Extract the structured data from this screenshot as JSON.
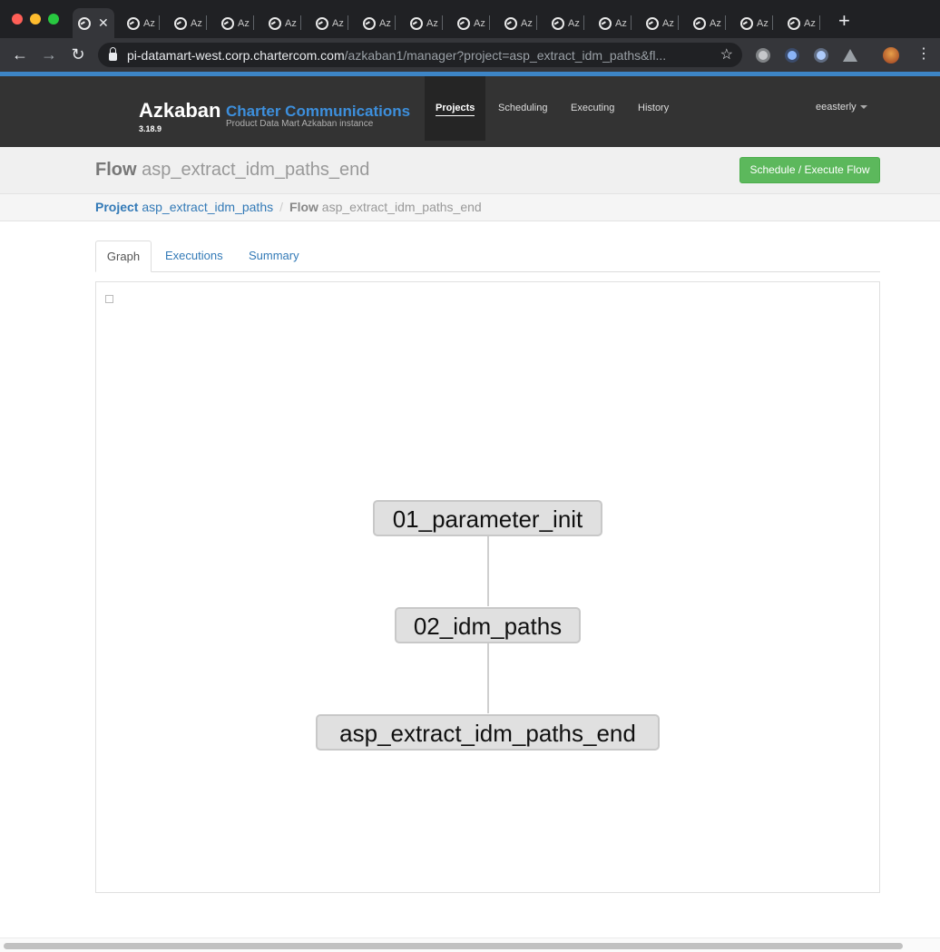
{
  "browser": {
    "tab_label": "Az",
    "tab_count": 16,
    "new_tab_label": "+",
    "url_host": "pi-datamart-west.corp.chartercom.com",
    "url_path": "/azkaban1/manager?project=asp_extract_idm_paths&fl..."
  },
  "navbar": {
    "brand": "Azkaban",
    "org": "Charter Communications",
    "version": "3.18.9",
    "subtitle": "Product Data Mart Azkaban instance",
    "items": [
      {
        "label": "Projects"
      },
      {
        "label": "Scheduling"
      },
      {
        "label": "Executing"
      },
      {
        "label": "History"
      }
    ],
    "user": "eeasterly"
  },
  "header": {
    "title_prefix": "Flow",
    "title_name": "asp_extract_idm_paths_end",
    "action_button": "Schedule / Execute Flow"
  },
  "breadcrumb": {
    "project_label": "Project",
    "project_name": "asp_extract_idm_paths",
    "flow_label": "Flow",
    "flow_name": "asp_extract_idm_paths_end",
    "separator": "/"
  },
  "tabs": [
    {
      "label": "Graph"
    },
    {
      "label": "Executions"
    },
    {
      "label": "Summary"
    }
  ],
  "graph": {
    "nodes": [
      {
        "label": "01_parameter_init"
      },
      {
        "label": "02_idm_paths"
      },
      {
        "label": "asp_extract_idm_paths_end"
      }
    ]
  }
}
